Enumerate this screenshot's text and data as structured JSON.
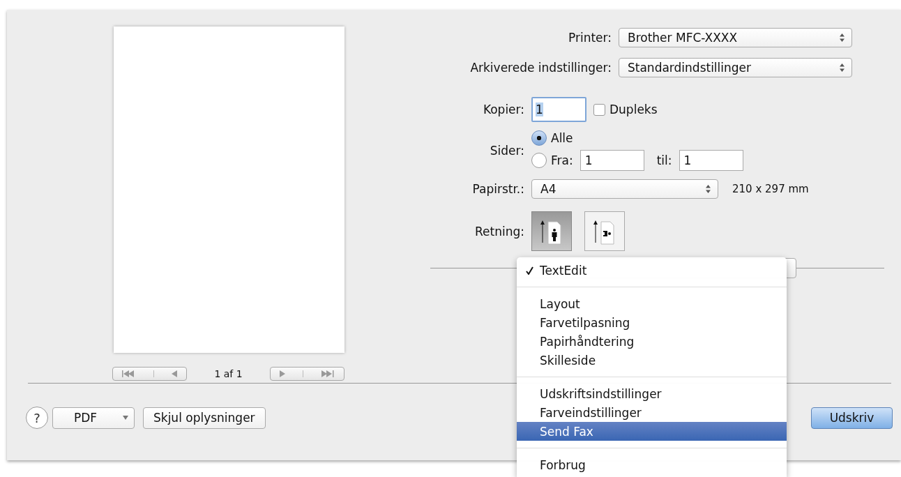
{
  "printer": {
    "label": "Printer:",
    "value": "Brother MFC-XXXX"
  },
  "presets": {
    "label": "Arkiverede indstillinger:",
    "value": "Standardindstillinger"
  },
  "copies": {
    "label": "Kopier:",
    "value": "1"
  },
  "duplex": {
    "label": "Dupleks",
    "checked": false
  },
  "pages": {
    "label": "Sider:",
    "options": [
      {
        "label": "Alle",
        "selected": true
      },
      {
        "label": "Fra:",
        "selected": false
      }
    ],
    "from": "1",
    "to_label": "til:",
    "to": "1"
  },
  "paper_size": {
    "label": "Papirstr.:",
    "value": "A4",
    "dimensions": "210 x 297 mm"
  },
  "orientation": {
    "label": "Retning:",
    "options": [
      {
        "kind": "portrait",
        "selected": true
      },
      {
        "kind": "landscape",
        "selected": false
      }
    ]
  },
  "preview": {
    "page_count": "1 af 1"
  },
  "bottom": {
    "help": "?",
    "pdf": "PDF",
    "hide_details": "Skjul oplysninger",
    "print": "Udskriv"
  },
  "menu": {
    "sections": [
      [
        {
          "label": "TextEdit",
          "checked": true,
          "selected": false
        }
      ],
      [
        {
          "label": "Layout",
          "checked": false,
          "selected": false
        },
        {
          "label": "Farvetilpasning",
          "checked": false,
          "selected": false
        },
        {
          "label": "Papirhåndtering",
          "checked": false,
          "selected": false
        },
        {
          "label": "Skilleside",
          "checked": false,
          "selected": false
        }
      ],
      [
        {
          "label": "Udskriftsindstillinger",
          "checked": false,
          "selected": false
        },
        {
          "label": "Farveindstillinger",
          "checked": false,
          "selected": false
        },
        {
          "label": "Send Fax",
          "checked": false,
          "selected": true
        }
      ],
      [
        {
          "label": "Forbrug",
          "checked": false,
          "selected": false
        }
      ]
    ]
  }
}
